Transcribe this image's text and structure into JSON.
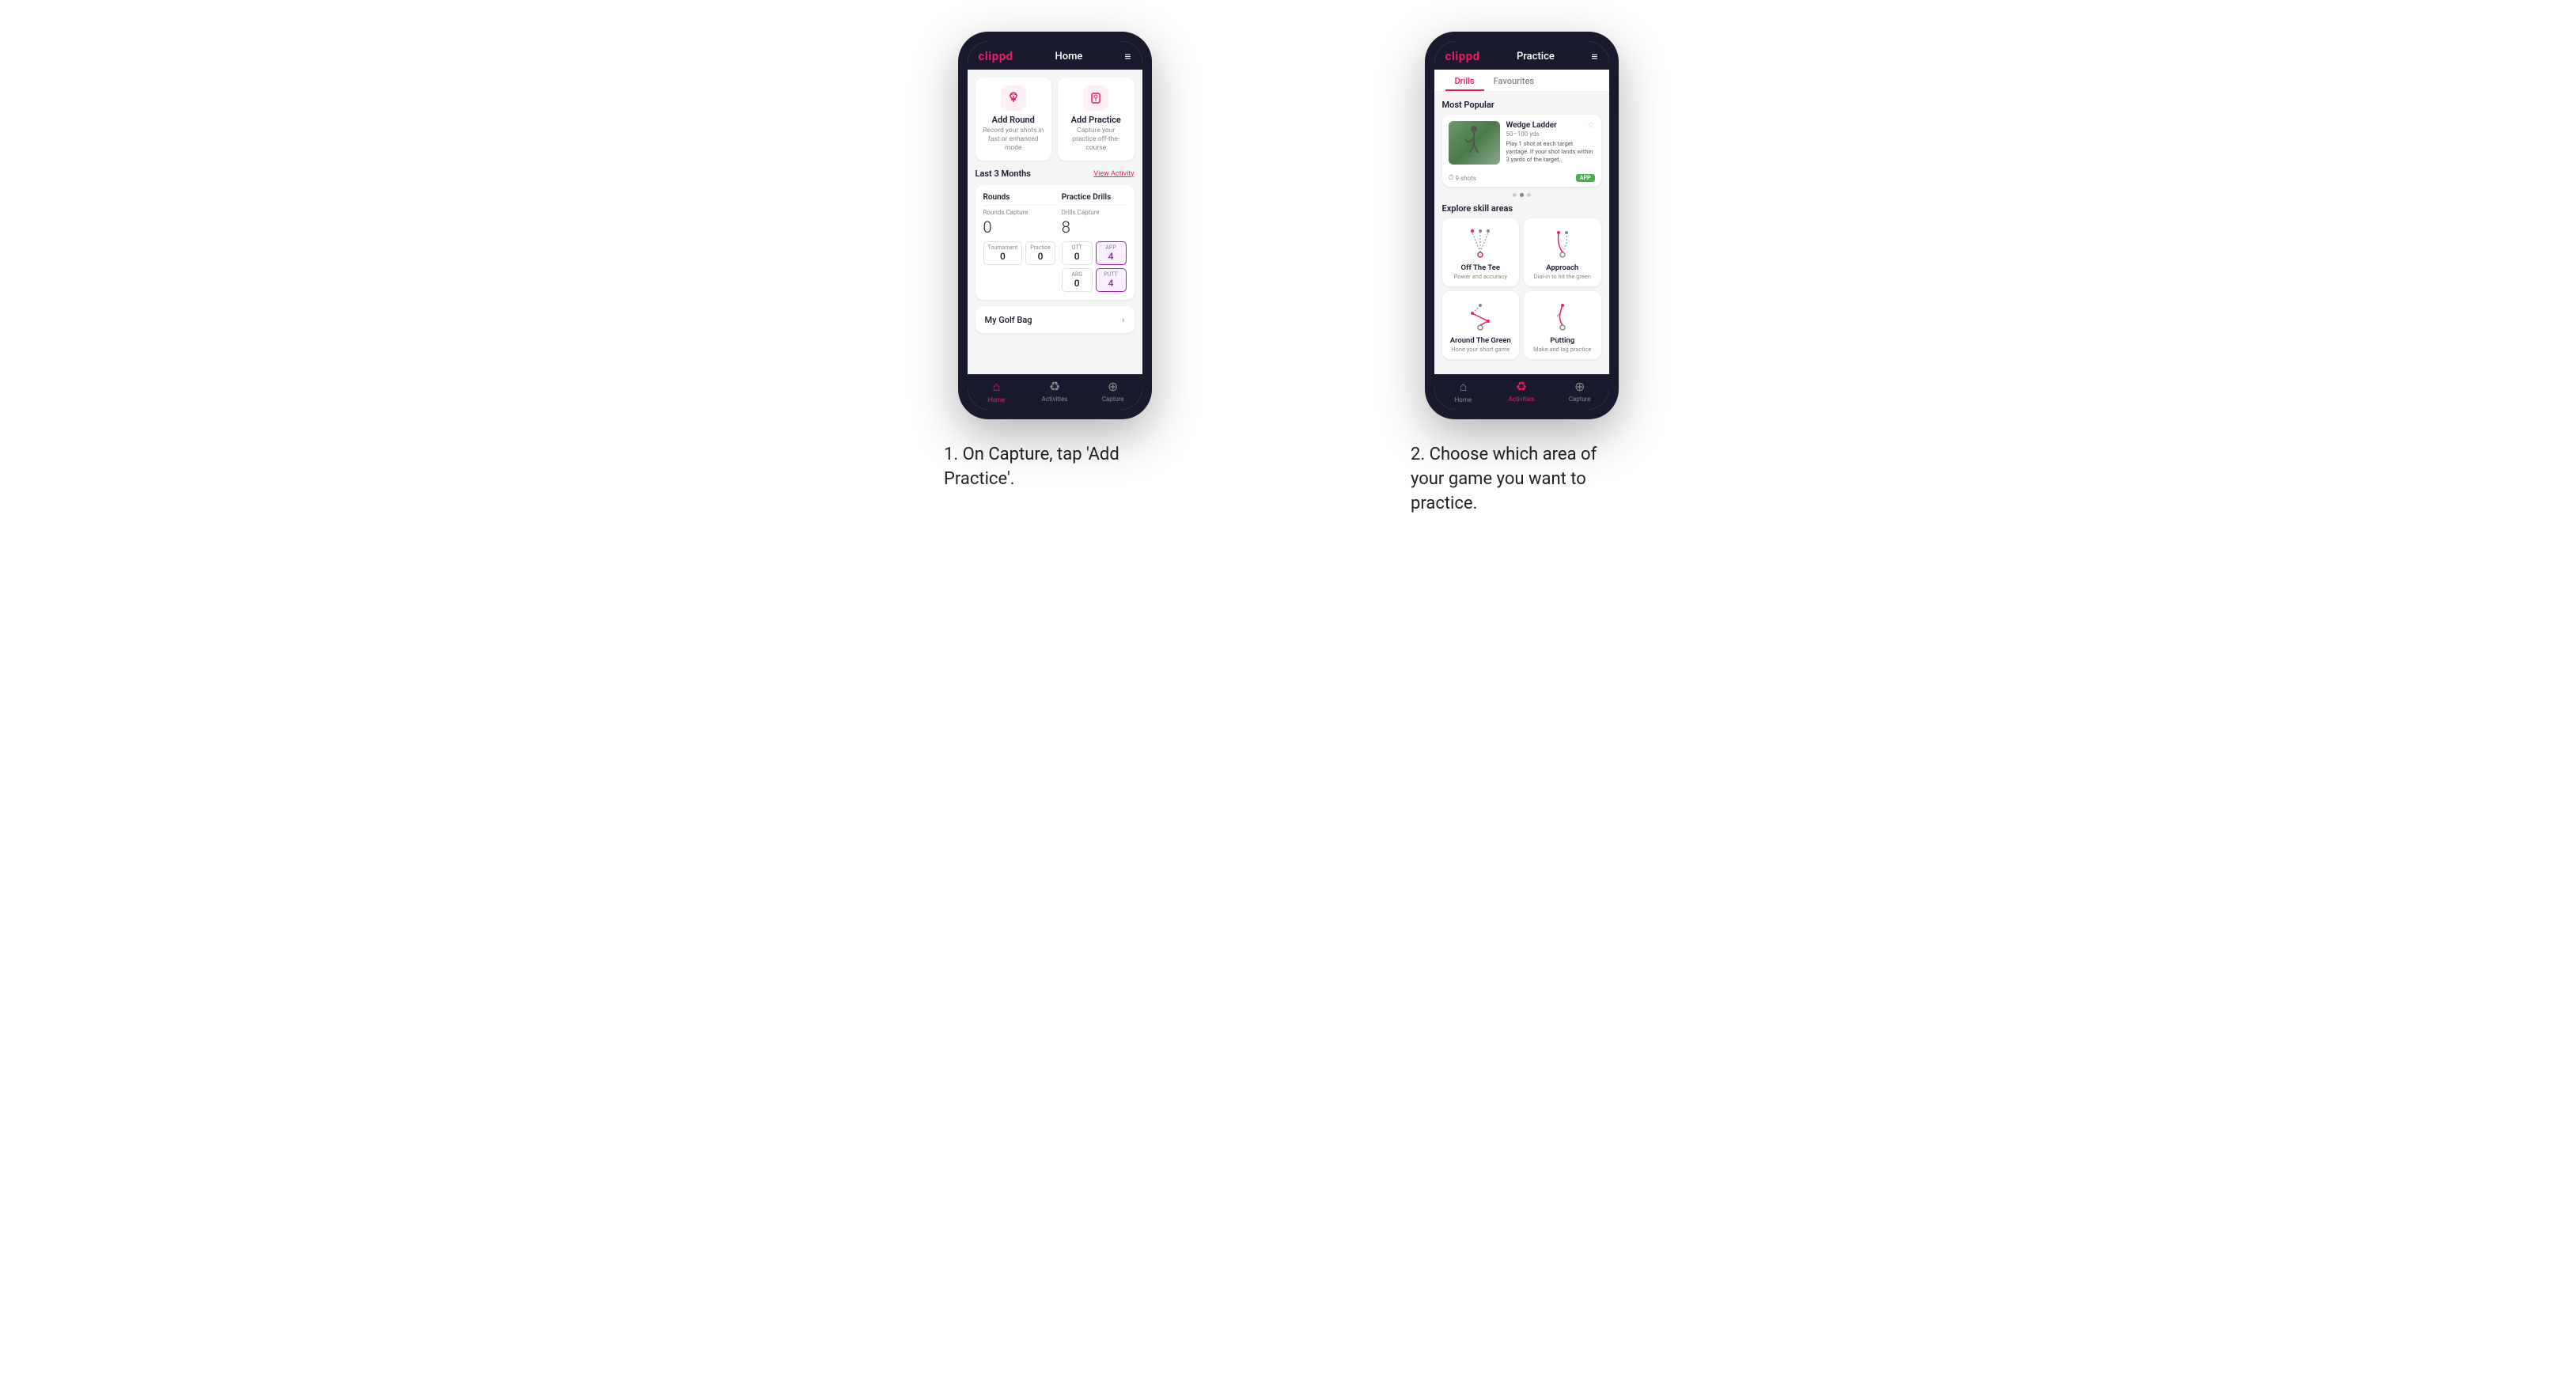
{
  "page": {
    "background": "#ffffff"
  },
  "phone1": {
    "header": {
      "logo": "clippd",
      "title": "Home",
      "menu_icon": "≡"
    },
    "action_cards": [
      {
        "id": "add-round",
        "title": "Add Round",
        "desc": "Record your shots in fast or enhanced mode",
        "icon": "⛳"
      },
      {
        "id": "add-practice",
        "title": "Add Practice",
        "desc": "Capture your practice off-the-course",
        "icon": "🎯"
      }
    ],
    "section": {
      "title": "Last 3 Months",
      "link": "View Activity"
    },
    "rounds": {
      "title": "Rounds",
      "capture_label": "Rounds Capture",
      "capture_value": "0",
      "tournament_label": "Tournament",
      "tournament_value": "0",
      "practice_label": "Practice",
      "practice_value": "0"
    },
    "practice_drills": {
      "title": "Practice Drills",
      "capture_label": "Drills Capture",
      "capture_value": "8",
      "ott_label": "OTT",
      "ott_value": "0",
      "app_label": "APP",
      "app_value": "4",
      "arg_label": "ARG",
      "arg_value": "0",
      "putt_label": "PUTT",
      "putt_value": "4"
    },
    "golf_bag": {
      "label": "My Golf Bag"
    },
    "nav": {
      "items": [
        {
          "label": "Home",
          "icon": "⌂",
          "active": true
        },
        {
          "label": "Activities",
          "icon": "♻",
          "active": false
        },
        {
          "label": "Capture",
          "icon": "⊕",
          "active": false
        }
      ]
    },
    "caption": "1. On Capture, tap 'Add Practice'."
  },
  "phone2": {
    "header": {
      "logo": "clippd",
      "title": "Practice",
      "menu_icon": "≡"
    },
    "tabs": [
      {
        "label": "Drills",
        "active": true
      },
      {
        "label": "Favourites",
        "active": false
      }
    ],
    "most_popular": {
      "title": "Most Popular",
      "drill": {
        "title": "Wedge Ladder",
        "yardage": "50–100 yds",
        "desc": "Play 1 shot at each target yardage. If your shot lands within 3 yards of the target..",
        "shots": "9 shots",
        "badge": "APP"
      },
      "dots": [
        {
          "active": false
        },
        {
          "active": true
        },
        {
          "active": false
        }
      ]
    },
    "skill_areas": {
      "title": "Explore skill areas",
      "skills": [
        {
          "id": "off-the-tee",
          "name": "Off The Tee",
          "desc": "Power and accuracy"
        },
        {
          "id": "approach",
          "name": "Approach",
          "desc": "Dial-in to hit the green"
        },
        {
          "id": "around-the-green",
          "name": "Around The Green",
          "desc": "Hone your short game"
        },
        {
          "id": "putting",
          "name": "Putting",
          "desc": "Make and lag practice"
        }
      ]
    },
    "nav": {
      "items": [
        {
          "label": "Home",
          "icon": "⌂",
          "active": false
        },
        {
          "label": "Activities",
          "icon": "♻",
          "active": true
        },
        {
          "label": "Capture",
          "icon": "⊕",
          "active": false
        }
      ]
    },
    "caption": "2. Choose which area of your game you want to practice."
  }
}
